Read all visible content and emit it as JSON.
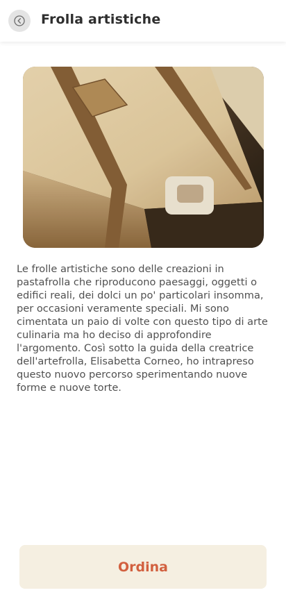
{
  "header": {
    "title": "Frolla artistiche",
    "back_icon": "chevron-left-circle-icon"
  },
  "hero": {
    "image_subject": "suitcase-shaped shortbread cake",
    "colors": {
      "crust": "#e9d3a8",
      "strap": "#8a6238",
      "background": "#2a2218"
    }
  },
  "content": {
    "description": "Le frolle artistiche sono delle creazioni in pastafrolla che riproducono paesaggi, oggetti o edifici reali, dei dolci un po' particolari insomma, per occasioni veramente speciali. Mi sono cimentata un paio di volte con questo tipo di arte culinaria ma ho deciso di approfondire l'argomento. Così sotto la guida della creatrice dell'artefrolla, Elisabetta Corneo, ho intrapreso questo nuovo percorso sperimentando nuove forme e nuove torte."
  },
  "footer": {
    "order_label": "Ordina",
    "accent_color": "#d2603f",
    "button_bg": "#f5efe1"
  }
}
